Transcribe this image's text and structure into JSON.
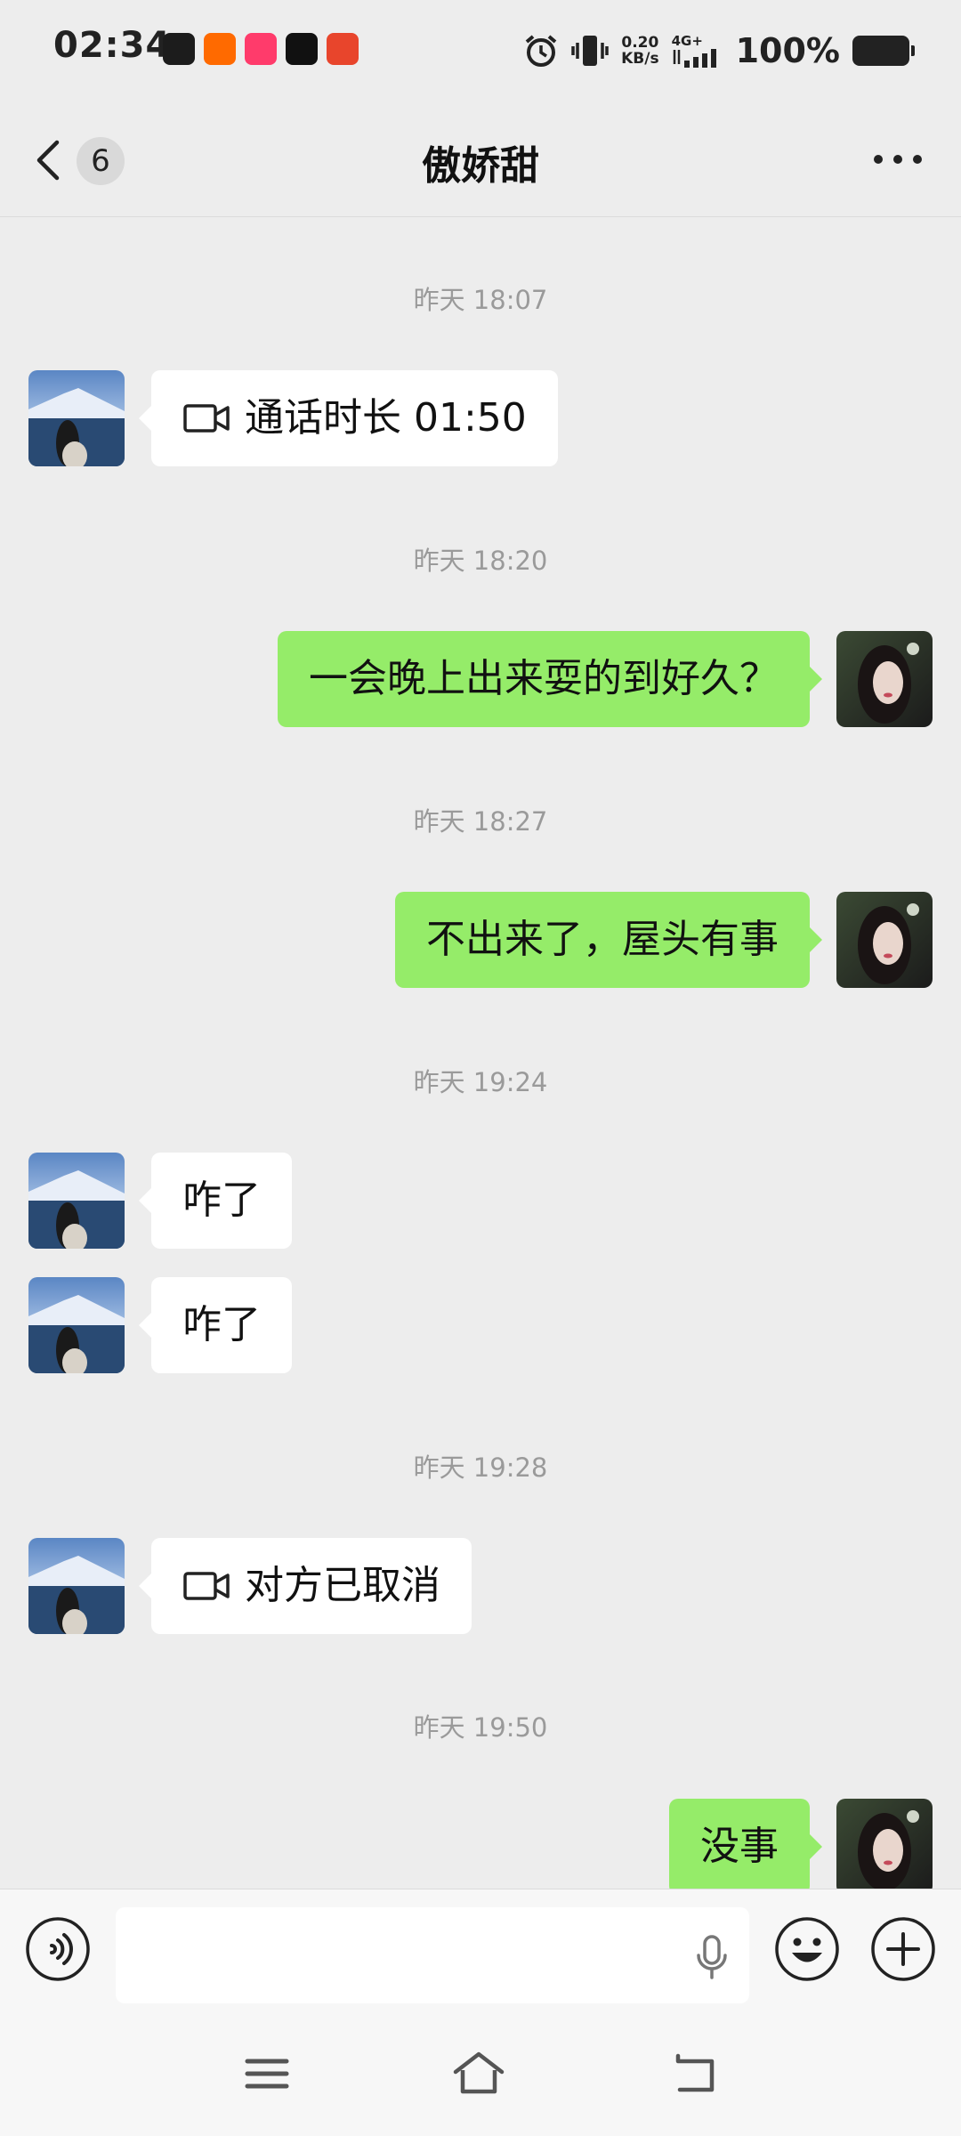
{
  "status_bar": {
    "time": "02:34",
    "apps": [
      "soul-app-icon",
      "kuaishou-app-icon",
      "kuaishou-lite-app-icon",
      "tiktok-app-icon",
      "toutiao-app-icon"
    ],
    "net_speed_value": "0.20",
    "net_speed_unit": "KB/s",
    "network_type": "4G+",
    "battery_percent": "100%"
  },
  "header": {
    "unread_count": "6",
    "title": "傲娇甜"
  },
  "chat": {
    "timestamps": [
      "昨天 18:07",
      "昨天 18:20",
      "昨天 18:27",
      "昨天 19:24",
      "昨天 19:28",
      "昨天 19:50"
    ],
    "messages": [
      {
        "side": "in",
        "type": "call",
        "text": "通话时长 01:50"
      },
      {
        "side": "out",
        "type": "text",
        "text": "一会晚上出来耍的到好久？"
      },
      {
        "side": "out",
        "type": "text",
        "text": "不出来了，屋头有事"
      },
      {
        "side": "in",
        "type": "text",
        "text": "咋了"
      },
      {
        "side": "in",
        "type": "text",
        "text": "咋了"
      },
      {
        "side": "in",
        "type": "call",
        "text": "对方已取消"
      },
      {
        "side": "out",
        "type": "text",
        "text": "没事"
      }
    ]
  },
  "input_bar": {
    "text_value": ""
  },
  "colors": {
    "background": "#ededed",
    "outgoing_bubble": "#95ec69",
    "incoming_bubble": "#ffffff",
    "timestamp_text": "#9a9a9a"
  }
}
